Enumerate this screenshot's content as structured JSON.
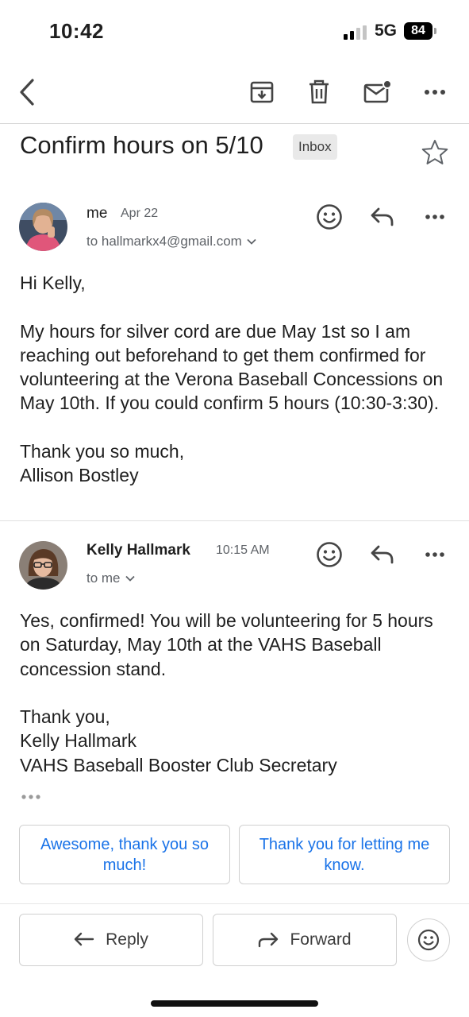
{
  "status": {
    "time": "10:42",
    "network": "5G",
    "battery": "84"
  },
  "toolbar": {
    "back_icon": "chevron-left-icon",
    "archive_icon": "archive-icon",
    "delete_icon": "trash-icon",
    "mark_unread_icon": "mail-unread-icon",
    "more_icon": "more-horizontal-icon"
  },
  "subject": "Confirm hours on 5/10",
  "label": "Inbox",
  "messages": [
    {
      "sender": "me",
      "date": "Apr 22",
      "recipients": "to hallmarkx4@gmail.com",
      "body": [
        "Hi Kelly,",
        "",
        "My hours for silver cord are due May 1st so I am reaching out beforehand to get them confirmed for volunteering at the Verona Baseball Concessions on May 10th. If you could confirm 5 hours (10:30-3:30).",
        "",
        "Thank you so much,",
        "Allison Bostley"
      ]
    },
    {
      "sender": "Kelly Hallmark",
      "date": "10:15 AM",
      "recipients": "to me",
      "body": [
        "Yes, confirmed!  You will be volunteering for 5 hours on Saturday, May 10th at the VAHS Baseball concession stand.",
        "",
        "Thank you,",
        "Kelly Hallmark",
        "VAHS Baseball Booster Club Secretary"
      ]
    }
  ],
  "smart_replies": [
    "Awesome, thank you so much!",
    "Thank you for letting me know."
  ],
  "actions": {
    "reply": "Reply",
    "forward": "Forward"
  },
  "colors": {
    "accent": "#1a73e8",
    "text": "#1f1f1f",
    "muted": "#5f6368"
  }
}
